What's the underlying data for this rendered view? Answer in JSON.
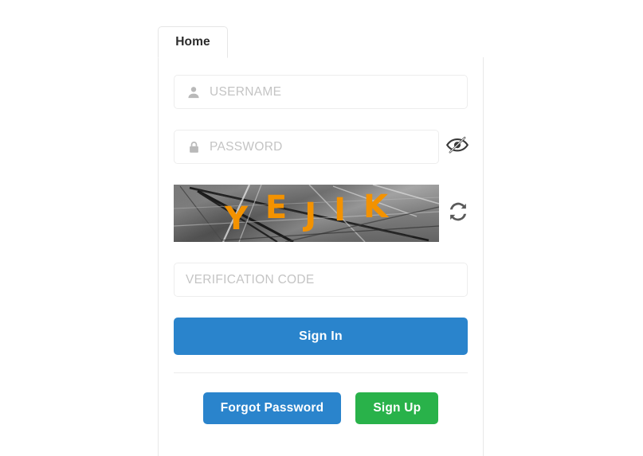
{
  "tabs": [
    {
      "label": "Home",
      "active": true
    }
  ],
  "form": {
    "username": {
      "placeholder": "USERNAME",
      "value": "",
      "icon": "user-icon"
    },
    "password": {
      "placeholder": "PASSWORD",
      "value": "",
      "icon": "lock-icon",
      "visibility_toggle_icon": "eye-slash-icon",
      "password_visible": false
    },
    "captcha": {
      "text": "YEJIK",
      "characters": [
        "Y",
        "E",
        "J",
        "I",
        "K"
      ],
      "refresh_icon": "refresh-icon",
      "text_color": "#f39200"
    },
    "verification_code": {
      "placeholder": "VERIFICATION CODE",
      "value": ""
    },
    "submit_label": "Sign In"
  },
  "footer": {
    "forgot_password_label": "Forgot Password",
    "sign_up_label": "Sign Up"
  },
  "colors": {
    "primary_blue": "#2a84cc",
    "success_green": "#29b24a",
    "captcha_orange": "#f39200",
    "placeholder_gray": "#c4c4c4",
    "border_gray": "#ededed"
  }
}
